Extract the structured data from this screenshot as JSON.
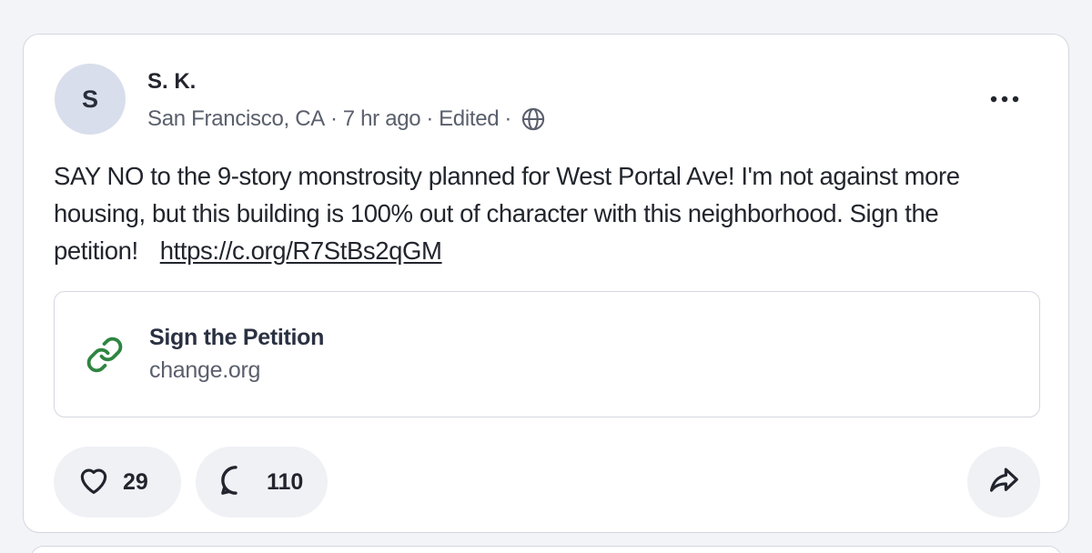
{
  "post": {
    "avatar_initial": "S",
    "author": "S. K.",
    "location": "San Francisco, CA",
    "time": "7 hr ago",
    "edited": "Edited",
    "separator": "·",
    "visibility_icon": "globe-icon",
    "body": "SAY NO to the 9-story monstrosity planned for West Portal Ave!  I'm not against more housing, but this building is 100% out of character with this neighborhood. Sign the petition!",
    "link_text": "https://c.org/R7StBs2qGM"
  },
  "link_preview": {
    "title": "Sign the Petition",
    "domain": "change.org",
    "icon": "link-icon",
    "icon_color": "#2e8540"
  },
  "actions": {
    "like_count": "29",
    "comment_count": "110",
    "like_icon": "heart-icon",
    "comment_icon": "speech-bubble-icon",
    "share_icon": "share-arrow-icon",
    "more_icon": "more-dots-icon"
  }
}
